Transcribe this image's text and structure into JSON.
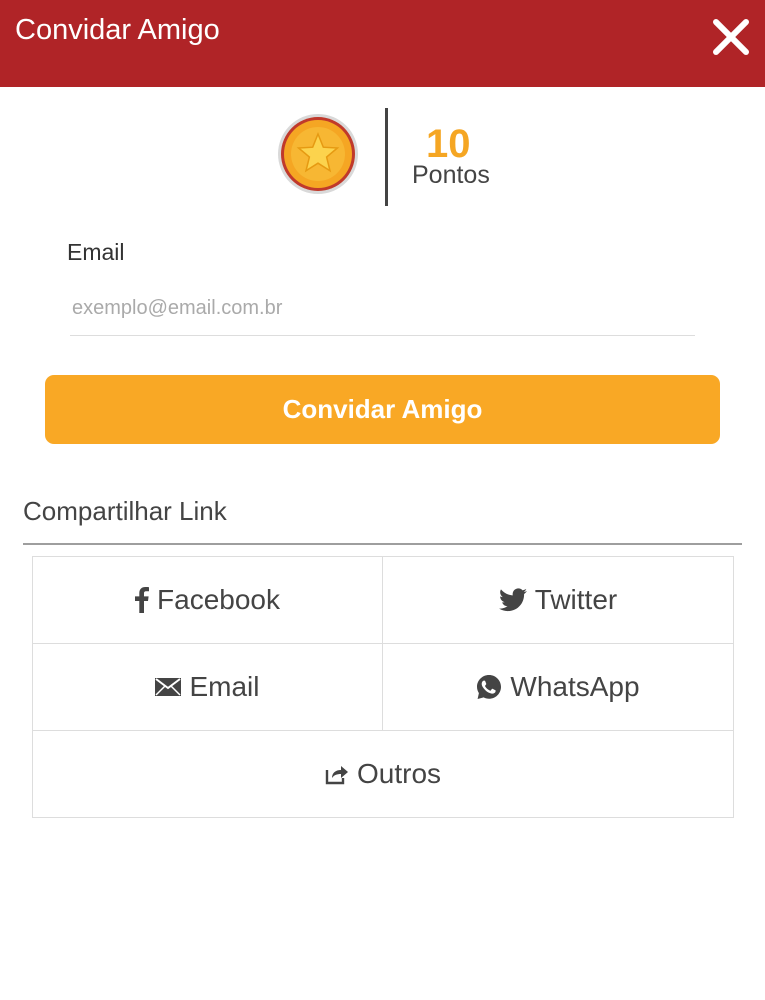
{
  "header": {
    "title": "Convidar Amigo",
    "close_icon": "close-icon"
  },
  "points": {
    "coin_icon": "star-coin-icon",
    "value": "10",
    "label": "Pontos"
  },
  "form": {
    "email_label": "Email",
    "email_placeholder": "exemplo@email.com.br",
    "email_value": "",
    "submit_label": "Convidar Amigo"
  },
  "share": {
    "title": "Compartilhar Link",
    "options": [
      {
        "label": "Facebook",
        "icon": "facebook-icon"
      },
      {
        "label": "Twitter",
        "icon": "twitter-icon"
      },
      {
        "label": "Email",
        "icon": "envelope-icon"
      },
      {
        "label": "WhatsApp",
        "icon": "whatsapp-icon"
      },
      {
        "label": "Outros",
        "icon": "share-icon"
      }
    ]
  },
  "colors": {
    "header_bg": "#b02427",
    "accent": "#f9a825",
    "points_value": "#f5a623",
    "text": "#444444"
  }
}
